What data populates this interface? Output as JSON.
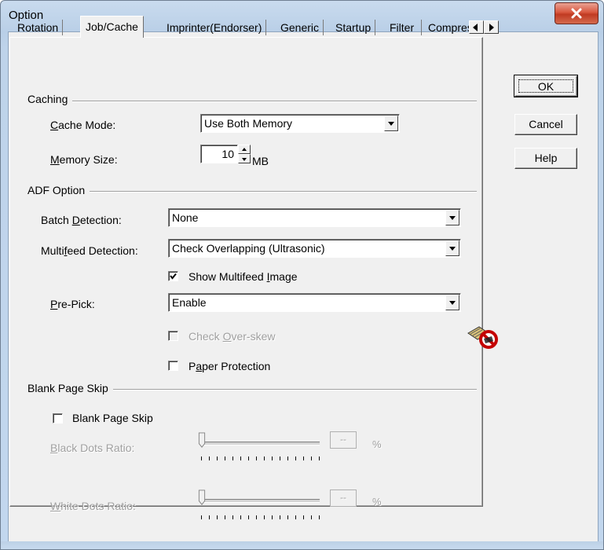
{
  "window": {
    "title": "Option",
    "close_glyph": "X"
  },
  "tabs": [
    {
      "label": "Rotation",
      "active": false
    },
    {
      "label": "Job/Cache",
      "active": true
    },
    {
      "label": "Imprinter(Endorser)",
      "active": false
    },
    {
      "label": "Generic",
      "active": false
    },
    {
      "label": "Startup",
      "active": false
    },
    {
      "label": "Filter",
      "active": false
    },
    {
      "label": "Compression",
      "active": false
    }
  ],
  "buttons": {
    "ok": "OK",
    "cancel": "Cancel",
    "help": "Help"
  },
  "caching": {
    "group_label": "Caching",
    "cache_mode": {
      "label_u": "C",
      "label_rest": "ache Mode:",
      "value": "Use Both Memory"
    },
    "memory_size": {
      "label_u": "M",
      "label_rest": "emory Size:",
      "value": "10",
      "unit": "MB"
    }
  },
  "adf": {
    "group_label": "ADF Option",
    "batch_detection": {
      "label_pre": "Batch ",
      "label_u": "D",
      "label_rest": "etection:",
      "value": "None"
    },
    "multifeed_detection": {
      "label_pre": "Multi",
      "label_u": "f",
      "label_rest": "eed Detection:",
      "value": "Check Overlapping (Ultrasonic)"
    },
    "show_multifeed": {
      "label_pre": "Show Multifeed ",
      "label_u": "I",
      "label_rest": "mage",
      "checked": true
    },
    "pre_pick": {
      "label_u": "P",
      "label_rest": "re-Pick:",
      "value": "Enable"
    },
    "check_overskew": {
      "label_pre": "Check ",
      "label_u": "O",
      "label_rest": "ver-skew",
      "checked": false,
      "enabled": false
    },
    "paper_protection": {
      "label_pre": "P",
      "label_u": "a",
      "label_rest": "per Protection",
      "checked": false
    }
  },
  "blank": {
    "group_label": "Blank Page Skip",
    "blank_page_skip": {
      "label": "Blank Page Skip",
      "checked": false
    },
    "black_dots": {
      "label_u": "B",
      "label_rest": "lack Dots Ratio:",
      "value": "--",
      "unit": "%",
      "slider_fraction": 0
    },
    "white_dots": {
      "label_u": "W",
      "label_rest": "hite Dots Ratio:",
      "value": "--",
      "unit": "%",
      "slider_fraction": 0
    }
  },
  "icons": {
    "no_skew": "no-overskew-icon"
  }
}
